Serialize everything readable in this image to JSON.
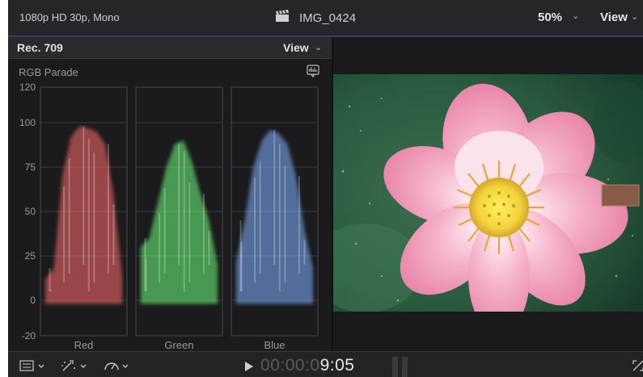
{
  "header": {
    "format": "1080p HD 30p, Mono",
    "clip_icon": "clapperboard-icon",
    "clip_name": "IMG_0424",
    "zoom": "50%",
    "view_label": "View"
  },
  "scope": {
    "standard": "Rec. 709",
    "view_label": "View",
    "mode": "RGB Parade",
    "settings_icon": "scope-settings-icon",
    "y_ticks": [
      "120",
      "100",
      "75",
      "50",
      "25",
      "0",
      "-20"
    ],
    "channels": [
      {
        "label": "Red",
        "color": "#ff6b6b"
      },
      {
        "label": "Green",
        "color": "#6cff7a"
      },
      {
        "label": "Blue",
        "color": "#7fb0ff"
      }
    ]
  },
  "playback": {
    "timecode_dim": "00:00:0",
    "timecode_bright": "9:05",
    "icons": [
      "viewer-layout-icon",
      "transform-icon",
      "speed-icon",
      "play-icon",
      "pause-icon",
      "fullscreen-icon"
    ]
  },
  "chart_data": {
    "type": "area",
    "title": "RGB Parade",
    "ylim": [
      -20,
      120
    ],
    "yticks": [
      120,
      100,
      75,
      50,
      25,
      0,
      -20
    ],
    "series": [
      {
        "name": "Red",
        "values": [
          12,
          18,
          70,
          92,
          98,
          97,
          95,
          88,
          60,
          14
        ]
      },
      {
        "name": "Green",
        "values": [
          30,
          35,
          55,
          75,
          88,
          90,
          78,
          60,
          45,
          20
        ]
      },
      {
        "name": "Blue",
        "values": [
          22,
          45,
          75,
          90,
          96,
          94,
          88,
          70,
          40,
          18
        ]
      }
    ]
  }
}
